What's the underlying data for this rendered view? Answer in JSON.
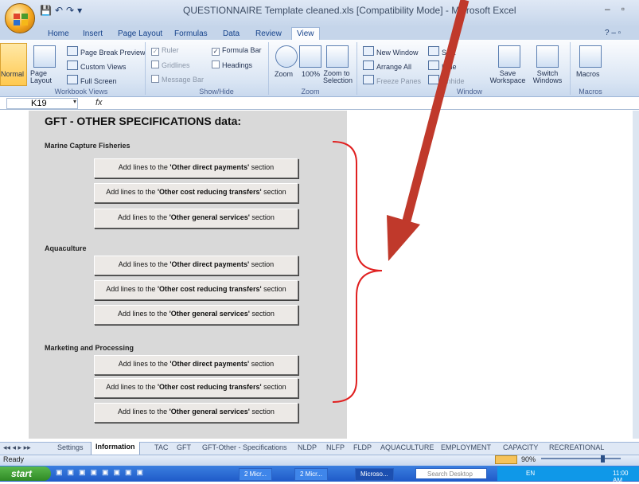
{
  "window": {
    "title": "QUESTIONNAIRE Template cleaned.xls  [Compatibility Mode] - Microsoft Excel",
    "controls": [
      "–",
      "▫"
    ]
  },
  "qat": [
    "💾",
    "↶",
    "↷",
    "▾"
  ],
  "ribbon_tabs": [
    "Home",
    "Insert",
    "Page Layout",
    "Formulas",
    "Data",
    "Review",
    "View"
  ],
  "active_tab": "View",
  "ribbon": {
    "workbook_views": {
      "label": "Workbook Views",
      "normal": "Normal",
      "page_layout": "Page Layout",
      "page_break_preview": "Page Break Preview",
      "custom_views": "Custom Views",
      "full_screen": "Full Screen"
    },
    "show_hide": {
      "label": "Show/Hide",
      "ruler": "Ruler",
      "gridlines": "Gridlines",
      "message_bar": "Message Bar",
      "formula_bar": "Formula Bar",
      "headings": "Headings"
    },
    "zoom": {
      "label": "Zoom",
      "zoom": "Zoom",
      "hundred": "100%",
      "zoom_to_selection": "Zoom to Selection"
    },
    "window": {
      "label": "Window",
      "new_window": "New Window",
      "arrange_all": "Arrange All",
      "freeze_panes": "Freeze Panes",
      "split": "Split",
      "hide": "Hide",
      "unhide": "Unhide",
      "save_workspace": "Save Workspace",
      "switch_windows": "Switch Windows"
    },
    "macros": {
      "label": "Macros",
      "macros": "Macros"
    }
  },
  "formula_bar": {
    "name_box": "K19",
    "fx": "fx"
  },
  "sheet": {
    "title": "GFT - OTHER SPECIFICATIONS data:",
    "sections": [
      {
        "name": "Marine Capture Fisheries",
        "buttons": [
          {
            "prefix": "Add lines to the ",
            "bold": "'Other direct payments'",
            "suffix": " section"
          },
          {
            "prefix": "Add lines to the ",
            "bold": "'Other cost reducing transfers'",
            "suffix": " section"
          },
          {
            "prefix": "Add lines to the ",
            "bold": "'Other general services'",
            "suffix": " section"
          }
        ]
      },
      {
        "name": "Aquaculture",
        "buttons": [
          {
            "prefix": "Add lines to the ",
            "bold": "'Other direct payments'",
            "suffix": " section"
          },
          {
            "prefix": "Add lines to the ",
            "bold": "'Other cost reducing transfers'",
            "suffix": " section"
          },
          {
            "prefix": "Add lines to the ",
            "bold": "'Other general services'",
            "suffix": " section"
          }
        ]
      },
      {
        "name": "Marketing and Processing",
        "buttons": [
          {
            "prefix": "Add lines to the ",
            "bold": "'Other direct payments'",
            "suffix": " section"
          },
          {
            "prefix": "Add lines to the ",
            "bold": "'Other cost reducing transfers'",
            "suffix": " section"
          },
          {
            "prefix": "Add lines to the ",
            "bold": "'Other general services'",
            "suffix": " section"
          }
        ]
      }
    ]
  },
  "sheet_tabs": [
    "Settings",
    "Information",
    "TAC",
    "GFT",
    "GFT-Other - Specifications",
    "NLDP",
    "NLFP",
    "FLDP",
    "AQUACULTURE",
    "EMPLOYMENT",
    "CAPACITY",
    "RECREATIONAL"
  ],
  "active_sheet_tab": "Information",
  "sheet_nav": "◂◂ ◂ ▸ ▸▸",
  "status": {
    "text": "Ready",
    "zoom": "90%"
  },
  "taskbar": {
    "start": "start",
    "tasks": [
      "2 Micr...",
      "2 Micr...",
      "Microso..."
    ],
    "search": "Search Desktop",
    "lang": "EN",
    "clock": "11:00 AM"
  },
  "annotation_colors": {
    "arrow": "#c0392b",
    "brace": "#e02020"
  }
}
